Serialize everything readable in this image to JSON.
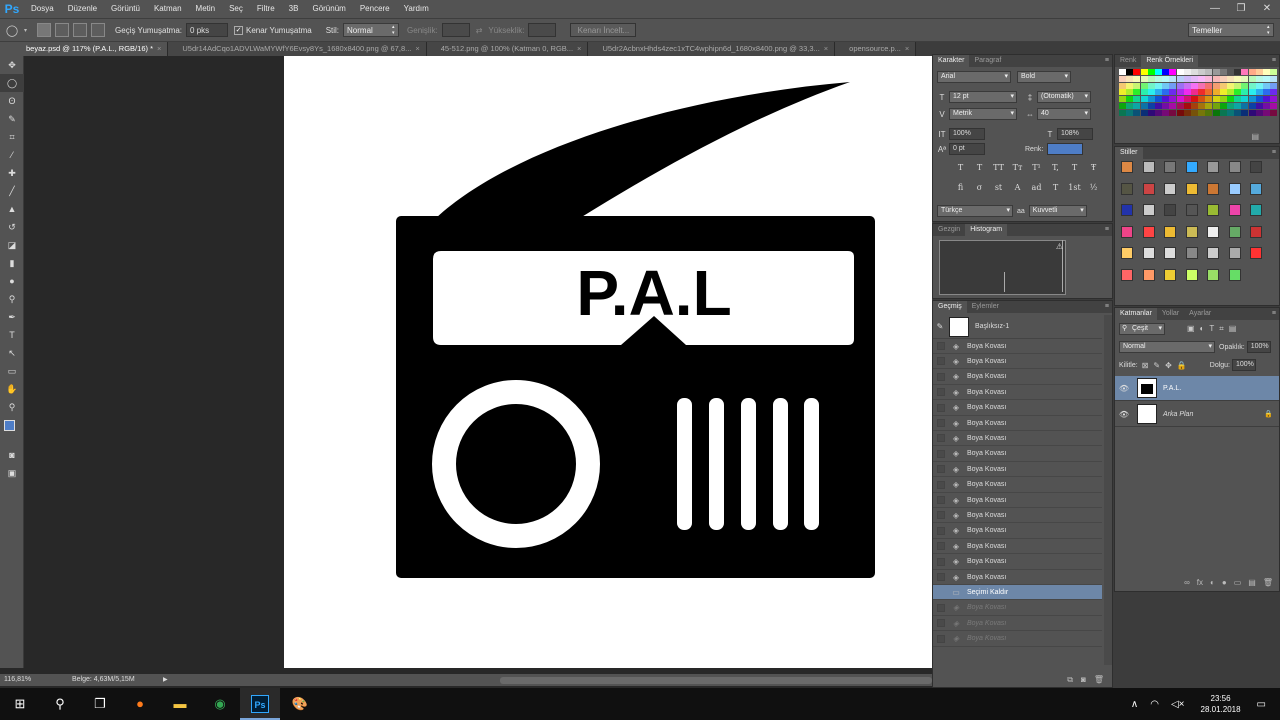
{
  "app": {
    "logo": "Ps"
  },
  "menu": [
    "Dosya",
    "Düzenle",
    "Görüntü",
    "Katman",
    "Metin",
    "Seç",
    "Filtre",
    "3B",
    "Görünüm",
    "Pencere",
    "Yardım"
  ],
  "window_controls": {
    "minimize": "—",
    "restore": "❐",
    "close": "✕"
  },
  "options": {
    "feather_label": "Geçiş Yumuşatma:",
    "feather_value": "0 pks",
    "antialias_label": "Kenar Yumuşatma",
    "style_label": "Stil:",
    "style_value": "Normal",
    "width_label": "Genişlik:",
    "height_label": "Yükseklik:",
    "refine_button": "Kenarı İncelt...",
    "workspace": "Temeller"
  },
  "tabs": [
    "beyaz.psd @ 117% (P.A.L., RGB/16) *",
    "U5dr14AdCqo1ADVLWaMYWfY6Evsy8Ys_1680x8400.png @ 67,8...",
    "45-512.png @ 100% (Katman 0, RGB...",
    "U5dr2AcbnxHhds4zec1xTC4wphipn6d_1680x8400.png @ 33,3...",
    "opensource.p..."
  ],
  "tab_close": "×",
  "artwork": {
    "label": "P.A.L"
  },
  "status": {
    "zoom": "116,81%",
    "doc": "Belge: 4,63M/5,15M",
    "arrow": "▶"
  },
  "character": {
    "tabs": [
      "Karakter",
      "Paragraf"
    ],
    "font": "Arial",
    "font_style": "Bold",
    "size": "12 pt",
    "leading": "(Otomatik)",
    "kerning": "Metrik",
    "tracking": "40",
    "vscale": "100%",
    "hscale": "108%",
    "baseline": "0 pt",
    "color_label": "Renk:",
    "color": "#4e7dc6",
    "style_buttons_1": [
      "T",
      "T",
      "TT",
      "Tт",
      "T¹",
      "T,",
      "T",
      "Ŧ"
    ],
    "style_buttons_2": [
      "fi",
      "σ",
      "st",
      "A",
      "ad",
      "T",
      "1st",
      "½"
    ],
    "language": "Türkçe",
    "aa_label": "aa",
    "aa": "Kuvvetli"
  },
  "navigator": {
    "tabs": [
      "Gezgin",
      "Histogram"
    ],
    "warn": "⚠"
  },
  "history": {
    "tabs": [
      "Geçmiş",
      "Eylemler"
    ],
    "snapshot": "Başlıksız-1",
    "items": [
      "Boya Kovası",
      "Boya Kovası",
      "Boya Kovası",
      "Boya Kovası",
      "Boya Kovası",
      "Boya Kovası",
      "Boya Kovası",
      "Boya Kovası",
      "Boya Kovası",
      "Boya Kovası",
      "Boya Kovası",
      "Boya Kovası",
      "Boya Kovası",
      "Boya Kovası",
      "Boya Kovası",
      "Boya Kovası"
    ],
    "selected": "Seçimi Kaldır",
    "undone": [
      "Boya Kovası",
      "Boya Kovası",
      "Boya Kovası"
    ]
  },
  "swatches": {
    "tabs": [
      "Renk",
      "Renk Örnekleri"
    ]
  },
  "styles": {
    "tab": "Stiller"
  },
  "layers": {
    "tabs": [
      "Katmanlar",
      "Yollar",
      "Ayarlar"
    ],
    "filter": "Çeşit",
    "blend": "Normal",
    "opacity_label": "Opaklık:",
    "opacity": "100%",
    "lock_label": "Kilitle:",
    "fill_label": "Dolgu:",
    "fill": "100%",
    "items": [
      {
        "name": "P.A.L."
      },
      {
        "name": "Arka Plan"
      }
    ],
    "footer_icons": [
      "∞",
      "fx",
      "◐",
      "●",
      "▭",
      "▤",
      "🗑"
    ]
  },
  "taskbar": {
    "time": "23:56",
    "date": "28.01.2018",
    "photoshop": "Ps"
  }
}
